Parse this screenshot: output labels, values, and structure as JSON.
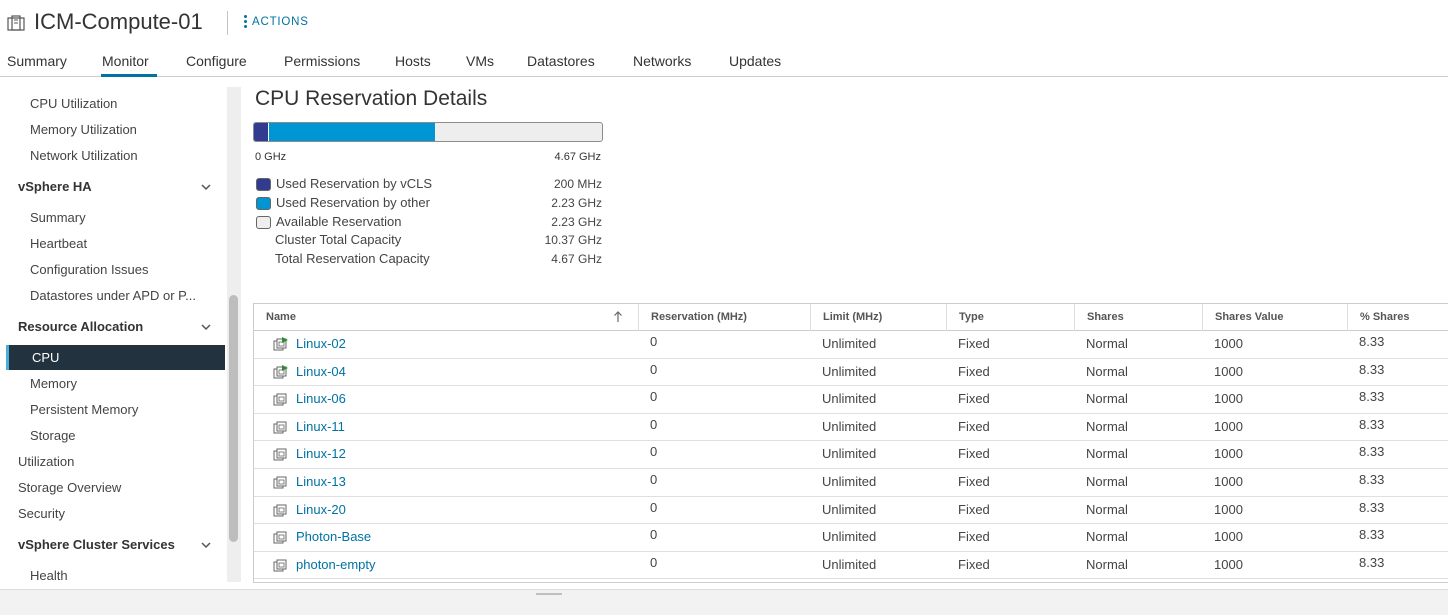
{
  "header": {
    "title": "ICM-Compute-01",
    "actions_label": "ACTIONS"
  },
  "tabs": [
    {
      "label": "Summary"
    },
    {
      "label": "Monitor",
      "active": true
    },
    {
      "label": "Configure"
    },
    {
      "label": "Permissions"
    },
    {
      "label": "Hosts"
    },
    {
      "label": "VMs"
    },
    {
      "label": "Datastores"
    },
    {
      "label": "Networks"
    },
    {
      "label": "Updates"
    }
  ],
  "sidebar": {
    "items": [
      {
        "label": "CPU Utilization"
      },
      {
        "label": "Memory Utilization"
      },
      {
        "label": "Network Utilization"
      },
      {
        "label": "vSphere HA",
        "group": true,
        "expanded": true
      },
      {
        "label": "Summary"
      },
      {
        "label": "Heartbeat"
      },
      {
        "label": "Configuration Issues"
      },
      {
        "label": "Datastores under APD or P..."
      },
      {
        "label": "Resource Allocation",
        "group": true,
        "expanded": true
      },
      {
        "label": "CPU",
        "selected": true
      },
      {
        "label": "Memory"
      },
      {
        "label": "Persistent Memory"
      },
      {
        "label": "Storage"
      },
      {
        "label": "Utilization"
      },
      {
        "label": "Storage Overview"
      },
      {
        "label": "Security"
      },
      {
        "label": "vSphere Cluster Services",
        "group": true,
        "expanded": true
      },
      {
        "label": "Health"
      }
    ]
  },
  "reservation": {
    "title": "CPU Reservation Details",
    "bar_min": "0 GHz",
    "bar_max": "4.67 GHz",
    "fill_fraction": {
      "vcls": 0.043,
      "other": 0.477
    },
    "legend": [
      {
        "label": "Used Reservation by vCLS",
        "value": "200 MHz",
        "color": "#313b8f"
      },
      {
        "label": "Used Reservation by other",
        "value": "2.23 GHz",
        "color": "#0095d3"
      },
      {
        "label": "Available Reservation",
        "value": "2.23 GHz",
        "color": "#eeeeee"
      },
      {
        "label": "Cluster Total Capacity",
        "value": "10.37 GHz"
      },
      {
        "label": "Total Reservation Capacity",
        "value": "4.67 GHz"
      }
    ]
  },
  "table": {
    "columns": [
      "Name",
      "Reservation (MHz)",
      "Limit (MHz)",
      "Type",
      "Shares",
      "Shares Value",
      "% Shares"
    ],
    "sort_icon": "sort-ascending-icon",
    "rows": [
      {
        "name": "Linux-02",
        "powered_on": true,
        "reservation": "0",
        "limit": "Unlimited",
        "type": "Fixed",
        "shares": "Normal",
        "shares_value": "1000",
        "pct_shares": "8.33"
      },
      {
        "name": "Linux-04",
        "powered_on": true,
        "reservation": "0",
        "limit": "Unlimited",
        "type": "Fixed",
        "shares": "Normal",
        "shares_value": "1000",
        "pct_shares": "8.33"
      },
      {
        "name": "Linux-06",
        "powered_on": false,
        "reservation": "0",
        "limit": "Unlimited",
        "type": "Fixed",
        "shares": "Normal",
        "shares_value": "1000",
        "pct_shares": "8.33"
      },
      {
        "name": "Linux-11",
        "powered_on": false,
        "reservation": "0",
        "limit": "Unlimited",
        "type": "Fixed",
        "shares": "Normal",
        "shares_value": "1000",
        "pct_shares": "8.33"
      },
      {
        "name": "Linux-12",
        "powered_on": false,
        "reservation": "0",
        "limit": "Unlimited",
        "type": "Fixed",
        "shares": "Normal",
        "shares_value": "1000",
        "pct_shares": "8.33"
      },
      {
        "name": "Linux-13",
        "powered_on": false,
        "reservation": "0",
        "limit": "Unlimited",
        "type": "Fixed",
        "shares": "Normal",
        "shares_value": "1000",
        "pct_shares": "8.33"
      },
      {
        "name": "Linux-20",
        "powered_on": false,
        "reservation": "0",
        "limit": "Unlimited",
        "type": "Fixed",
        "shares": "Normal",
        "shares_value": "1000",
        "pct_shares": "8.33"
      },
      {
        "name": "Photon-Base",
        "powered_on": false,
        "reservation": "0",
        "limit": "Unlimited",
        "type": "Fixed",
        "shares": "Normal",
        "shares_value": "1000",
        "pct_shares": "8.33"
      },
      {
        "name": "photon-empty",
        "powered_on": false,
        "reservation": "0",
        "limit": "Unlimited",
        "type": "Fixed",
        "shares": "Normal",
        "shares_value": "1000",
        "pct_shares": "8.33"
      }
    ]
  }
}
